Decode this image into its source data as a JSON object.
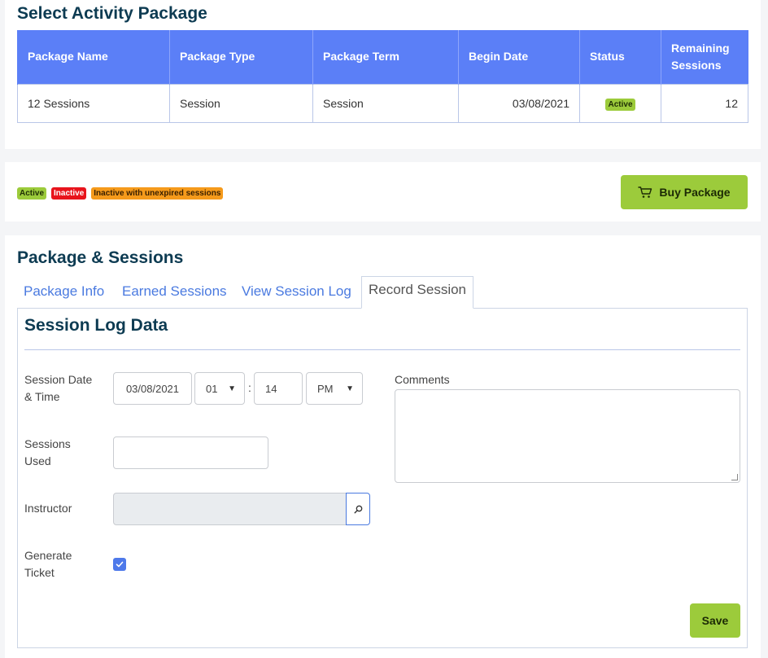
{
  "section1": {
    "title": "Select Activity Package",
    "columns": [
      "Package Name",
      "Package Type",
      "Package Term",
      "Begin Date",
      "Status",
      "Remaining Sessions"
    ],
    "rows": [
      {
        "name": "12 Sessions",
        "type": "Session",
        "term": "Session",
        "begin": "03/08/2021",
        "status": "Active",
        "remaining": "12"
      }
    ]
  },
  "legend": {
    "active": "Active",
    "inactive": "Inactive",
    "unexpired": "Inactive with unexpired sessions"
  },
  "buy_button": {
    "label": "Buy Package",
    "icon": "cart-icon"
  },
  "section3": {
    "title": "Package & Sessions",
    "tabs": [
      "Package Info",
      "Earned Sessions",
      "View Session Log",
      "Record Session"
    ],
    "active_tab": "Record Session"
  },
  "form": {
    "title": "Session Log Data",
    "date_label_1": "Session Date",
    "date_label_2": "& Time",
    "date_value": "03/08/2021",
    "hour_value": "01",
    "minute_value": "14",
    "ampm_value": "PM",
    "sessions_label_1": "Sessions",
    "sessions_label_2": "Used",
    "sessions_value": "",
    "instructor_label": "Instructor",
    "instructor_value": "",
    "ticket_label_1": "Generate",
    "ticket_label_2": "Ticket",
    "ticket_checked": true,
    "comments_label": "Comments",
    "comments_value": "",
    "save_label": "Save"
  },
  "colors": {
    "accent": "#5b7ff7",
    "title": "#0d3b52",
    "active_badge": "#9ccb3b",
    "inactive_badge": "#e8141c",
    "unexpired_badge": "#f59a1b",
    "primary_button": "#9ccb3b"
  }
}
